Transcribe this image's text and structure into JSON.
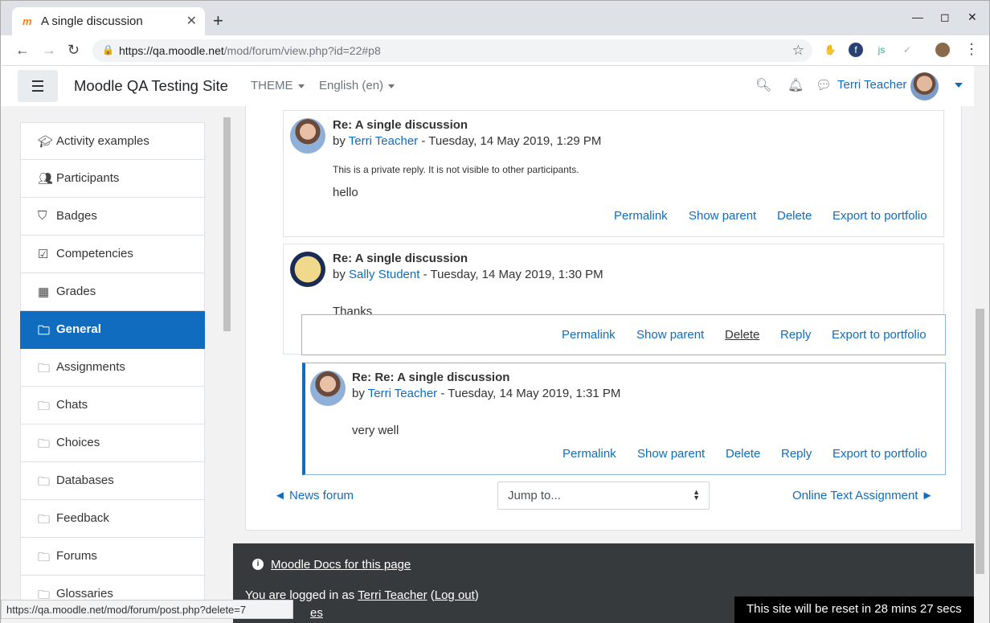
{
  "browser": {
    "tab_title": "A single discussion",
    "favicon": "m",
    "url_host": "https://qa.moodle.net",
    "url_path": "/mod/forum/view.php?id=22#p8",
    "status_url": "https://qa.moodle.net/mod/forum/post.php?delete=7"
  },
  "navbar": {
    "site_name": "Moodle QA Testing Site",
    "theme_label": "THEME",
    "language_label": "English (en)",
    "user_name": "Terri Teacher"
  },
  "sidebar": {
    "items": [
      {
        "label": "Activity examples",
        "icon": "graduation-cap-icon"
      },
      {
        "label": "Participants",
        "icon": "users-icon"
      },
      {
        "label": "Badges",
        "icon": "shield-icon"
      },
      {
        "label": "Competencies",
        "icon": "check-square-icon"
      },
      {
        "label": "Grades",
        "icon": "table-icon"
      },
      {
        "label": "General",
        "icon": "folder-icon",
        "active": true
      },
      {
        "label": "Assignments",
        "icon": "folder-icon"
      },
      {
        "label": "Chats",
        "icon": "folder-icon"
      },
      {
        "label": "Choices",
        "icon": "folder-icon"
      },
      {
        "label": "Databases",
        "icon": "folder-icon"
      },
      {
        "label": "Feedback",
        "icon": "folder-icon"
      },
      {
        "label": "Forums",
        "icon": "folder-icon"
      },
      {
        "label": "Glossaries",
        "icon": "folder-icon"
      }
    ]
  },
  "posts": [
    {
      "subject": "Re: A single discussion",
      "by": "by",
      "author": "Terri Teacher",
      "date": "- Tuesday, 14 May 2019, 1:29 PM",
      "private_note": "This is a private reply. It is not visible to other participants.",
      "body": "hello",
      "actions": [
        "Permalink",
        "Show parent",
        "Delete",
        "Export to portfolio"
      ]
    },
    {
      "subject": "Re: A single discussion",
      "by": "by",
      "author": "Sally Student",
      "date": "- Tuesday, 14 May 2019, 1:30 PM",
      "body": "Thanks",
      "actions": [
        "Permalink",
        "Show parent",
        "Delete",
        "Reply",
        "Export to portfolio"
      ]
    },
    {
      "subject": "Re: Re: A single discussion",
      "by": "by",
      "author": "Terri Teacher",
      "date": "- Tuesday, 14 May 2019, 1:31 PM",
      "body": "very well",
      "actions": [
        "Permalink",
        "Show parent",
        "Delete",
        "Reply",
        "Export to portfolio"
      ]
    }
  ],
  "pagenav": {
    "prev": "◄ News forum",
    "jump": "Jump to...",
    "next": "Online Text Assignment ►"
  },
  "footer": {
    "docs_link": "Moodle Docs for this page",
    "logged_prefix": "You are logged in as",
    "logged_user": "Terri Teacher",
    "logout": "Log out",
    "partial_link": "es",
    "reset_notice": "This site will be reset in 28 mins 27 secs"
  }
}
